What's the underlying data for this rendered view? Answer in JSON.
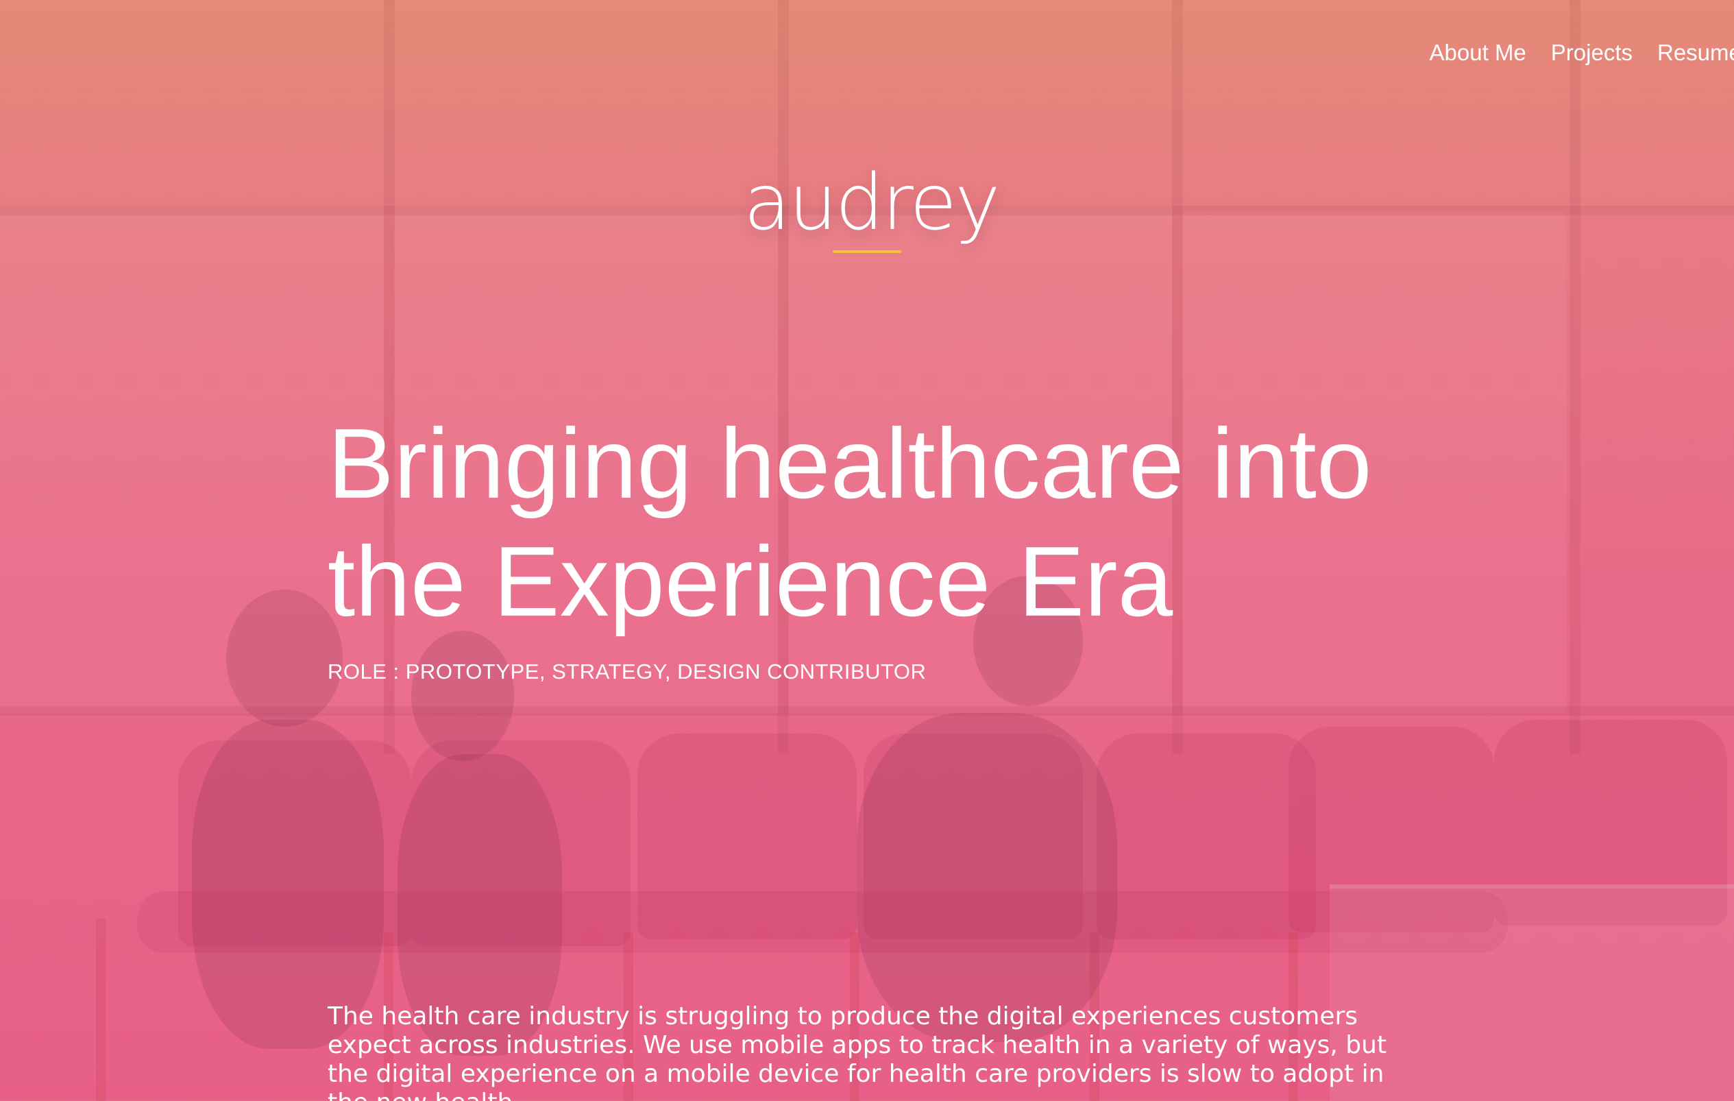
{
  "nav": {
    "items": [
      "About Me",
      "Projects",
      "Resume"
    ]
  },
  "logo": {
    "text": "audrey",
    "underline_color": "#f5c33b"
  },
  "hero": {
    "title_line1": "Bringing healthcare into",
    "title_line2": "the Experience Era",
    "role": "ROLE : PROTOTYPE, STRATEGY, DESIGN CONTRIBUTOR"
  },
  "intro": {
    "text": "The health care industry is struggling to produce the digital experiences customers expect across industries. We use mobile apps to track health in a variety of ways, but the digital experience on a mobile device for health care providers is slow to adopt in the new health"
  },
  "colors": {
    "overlay_top": "#e48a76",
    "overlay_bottom": "#e75f88",
    "text": "#ffffff"
  }
}
